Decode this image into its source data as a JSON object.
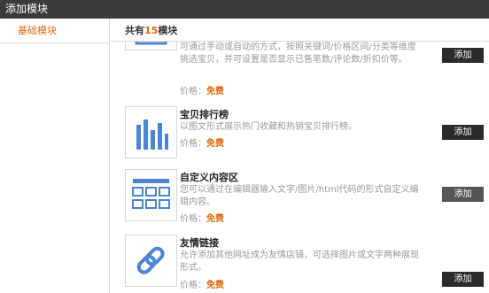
{
  "window": {
    "title": "添加模块"
  },
  "sidebar": {
    "items": [
      {
        "label": "基础模块"
      }
    ]
  },
  "main": {
    "count": {
      "prefix": "共有",
      "number": "15",
      "suffix": "模块"
    },
    "modules": [
      {
        "title": "",
        "desc": "可通过手动或自动的方式，按照关键词/价格区间/分类等维度挑选宝贝，并可设置是否显示已售笔数/评论数/折扣价等。",
        "price_label": "价格：",
        "price_value": "免费",
        "button": "添加",
        "icon": "upload-icon"
      },
      {
        "title": "宝贝排行榜",
        "desc": "以图文形式展示热门收藏和热销宝贝排行榜。",
        "price_label": "价格：",
        "price_value": "免费",
        "button": "添加",
        "icon": "bar-chart-icon"
      },
      {
        "title": "自定义内容区",
        "desc": "您可以通过在编辑器输入文字/图片/html代码的形式自定义编辑内容。",
        "price_label": "价格：",
        "price_value": "免费",
        "button": "添加",
        "icon": "grid-layout-icon"
      },
      {
        "title": "友情链接",
        "desc": "允许添加其他网址成为友情店铺，可选择图片或文字两种展现形式。",
        "price_label": "价格：",
        "price_value": "免费",
        "button": "添加",
        "icon": "link-icon"
      }
    ]
  },
  "colors": {
    "accent": "#e06a12",
    "icon_blue": "#4a86d4",
    "titlebar": "#3a3a3a",
    "button": "#2b2b2b"
  }
}
